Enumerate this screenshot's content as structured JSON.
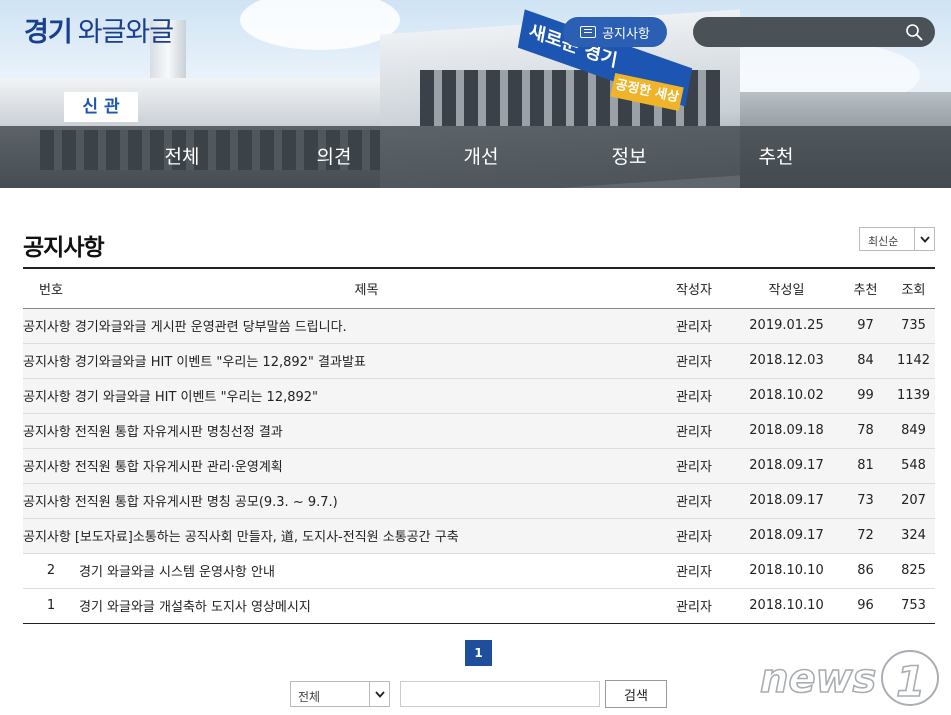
{
  "header": {
    "logo_bold": "경기",
    "logo_regular": "와글와글",
    "hero_sign": "새로운 경기",
    "hero_sign_sub": "공정한 세상",
    "hero_new_wing": "신 관",
    "notice_button": "공지사항",
    "search_placeholder": "",
    "icons": [
      "document-icon",
      "search-icon"
    ]
  },
  "nav": {
    "items": [
      {
        "label": "전체"
      },
      {
        "label": "의견"
      },
      {
        "label": "개선"
      },
      {
        "label": "정보"
      },
      {
        "label": "추천"
      }
    ]
  },
  "main": {
    "page_title": "공지사항",
    "sort_selected": "최신순",
    "table": {
      "columns": [
        "번호",
        "제목",
        "작성자",
        "작성일",
        "추천",
        "조회"
      ],
      "rows": [
        {
          "no": "공지사항",
          "title": "경기와글와글 게시판 운영관련 당부말씀 드립니다.",
          "author": "관리자",
          "date": "2019.01.25",
          "likes": "97",
          "views": "735",
          "notice": true
        },
        {
          "no": "공지사항",
          "title": "경기와글와글 HIT 이벤트 \"우리는 12,892\" 결과발표",
          "author": "관리자",
          "date": "2018.12.03",
          "likes": "84",
          "views": "1142",
          "notice": true
        },
        {
          "no": "공지사항",
          "title": "경기 와글와글 HIT 이벤트 \"우리는 12,892\"",
          "author": "관리자",
          "date": "2018.10.02",
          "likes": "99",
          "views": "1139",
          "notice": true
        },
        {
          "no": "공지사항",
          "title": "전직원 통합 자유게시판 명칭선정 결과",
          "author": "관리자",
          "date": "2018.09.18",
          "likes": "78",
          "views": "849",
          "notice": true
        },
        {
          "no": "공지사항",
          "title": "전직원 통합 자유게시판 관리·운영계획",
          "author": "관리자",
          "date": "2018.09.17",
          "likes": "81",
          "views": "548",
          "notice": true
        },
        {
          "no": "공지사항",
          "title": "전직원 통합 자유게시판 명칭 공모(9.3. ~ 9.7.)",
          "author": "관리자",
          "date": "2018.09.17",
          "likes": "73",
          "views": "207",
          "notice": true
        },
        {
          "no": "공지사항",
          "title": "[보도자료]소통하는 공직사회 만들자, 道, 도지사-전직원 소통공간 구축",
          "author": "관리자",
          "date": "2018.09.17",
          "likes": "72",
          "views": "324",
          "notice": true
        },
        {
          "no": "2",
          "title": "경기 와글와글 시스템 운영사항 안내",
          "author": "관리자",
          "date": "2018.10.10",
          "likes": "86",
          "views": "825",
          "notice": false
        },
        {
          "no": "1",
          "title": "경기 와글와글 개설축하 도지사 영상메시지",
          "author": "관리자",
          "date": "2018.10.10",
          "likes": "96",
          "views": "753",
          "notice": false
        }
      ]
    },
    "pagination": {
      "current": "1"
    },
    "search": {
      "field_selected": "전체",
      "keyword_value": "",
      "button_label": "검색"
    }
  },
  "watermark": {
    "text": "news1"
  },
  "colors": {
    "brand_blue": "#2b5fb3",
    "logo_blue": "#1b3f8f",
    "nav_bg": "#3c4248",
    "pager_blue": "#1d4f9c"
  }
}
